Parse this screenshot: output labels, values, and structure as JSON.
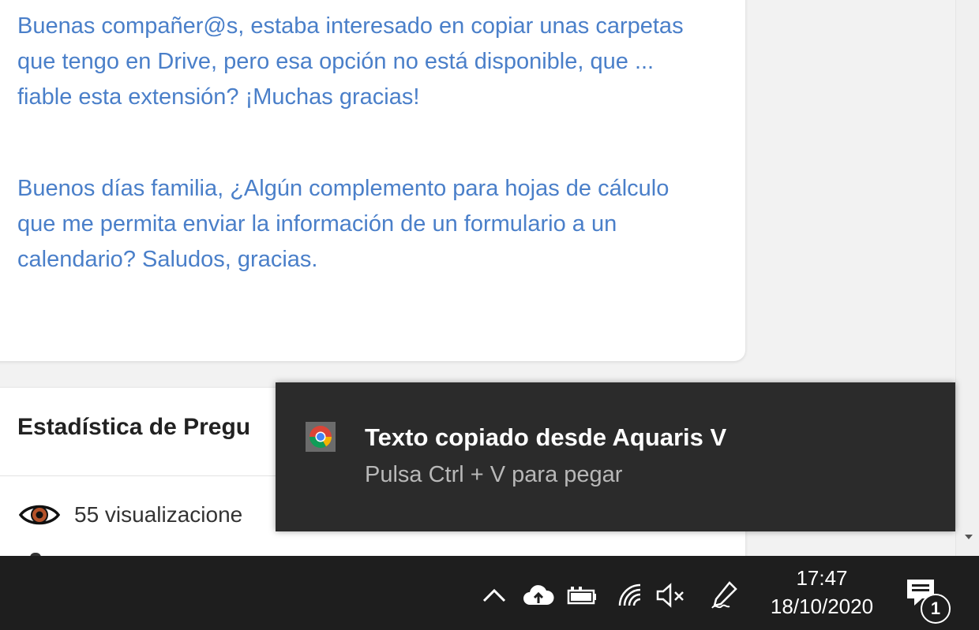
{
  "posts": [
    "Buenas compañer@s, estaba interesado en copiar unas carpetas que tengo en Drive, pero esa opción no está disponible, que ... fiable esta extensión? ¡Muchas gracias!",
    "Buenos días familia, ¿Algún complemento para hojas de cálculo que me permita enviar la información de un formulario a un calendario? Saludos, gracias."
  ],
  "stats": {
    "title": "Estadística de Pregu",
    "views": "55 visualizacione"
  },
  "toast": {
    "title": "Texto copiado desde Aquaris V",
    "message": "Pulsa Ctrl + V para pegar",
    "icon": "chrome-icon"
  },
  "taskbar": {
    "time": "17:47",
    "date": "18/10/2020",
    "notification_count": "1",
    "tray_icons": [
      "chevron-up-icon",
      "cloud-upload-icon",
      "battery-icon",
      "wifi-icon",
      "volume-muted-icon",
      "pen-icon"
    ]
  },
  "colors": {
    "post_text": "#4a7fc9",
    "toast_bg": "#2b2b2b",
    "taskbar_bg": "#1e1e1e"
  }
}
